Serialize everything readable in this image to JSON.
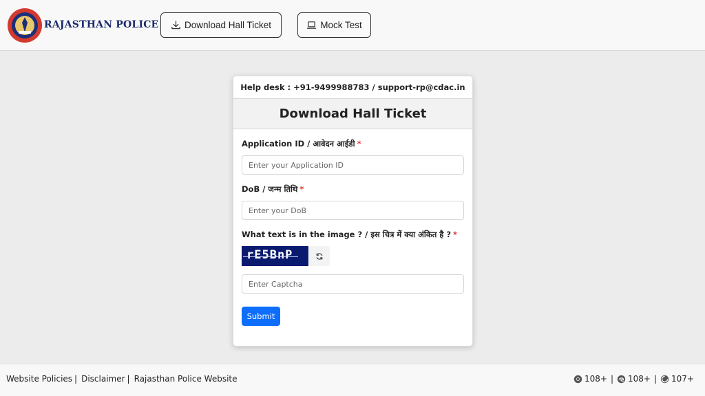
{
  "header": {
    "brand": "RAJASTHAN POLICE",
    "nav": [
      {
        "label": "Download Hall Ticket",
        "icon": "download-icon"
      },
      {
        "label": "Mock Test",
        "icon": "laptop-icon"
      }
    ]
  },
  "card": {
    "helpdesk": "Help desk : +91-9499988783 / support-rp@cdac.in",
    "title": "Download Hall Ticket",
    "fields": {
      "application_id": {
        "label": "Application ID / आवेदन आईडी",
        "required": "*",
        "placeholder": "Enter your Application ID",
        "value": ""
      },
      "dob": {
        "label": "DoB / जन्म तिथि",
        "required": "*",
        "placeholder": "Enter your DoB",
        "value": ""
      },
      "captcha": {
        "label": "What text is in the image ? / इस चित्र में क्या अंकित है ?",
        "required": "*",
        "placeholder": "Enter Captcha",
        "value": "",
        "image_text": "rE5BnP"
      }
    },
    "submit_label": "Submit"
  },
  "footer": {
    "links": [
      "Website Policies",
      "Disclaimer",
      "Rajasthan Police Website"
    ],
    "separator": "|",
    "browsers": [
      {
        "icon": "chrome-icon",
        "version": "108+"
      },
      {
        "icon": "edge-icon",
        "version": "108+"
      },
      {
        "icon": "firefox-icon",
        "version": "107+"
      }
    ]
  },
  "colors": {
    "brand_text": "#1a2a6c",
    "primary": "#0d6efd",
    "required": "#e53935",
    "captcha_bg": "#0a1a6e"
  }
}
